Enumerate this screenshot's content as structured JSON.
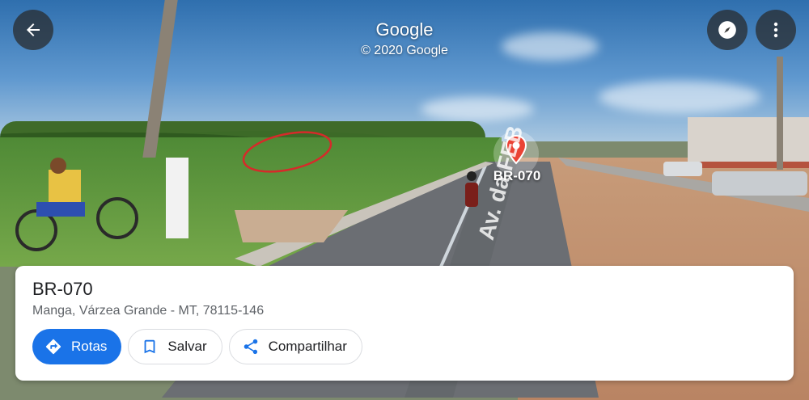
{
  "header": {
    "brand": "Google",
    "copyright": "© 2020 Google",
    "back_icon": "arrow-back-icon",
    "compass_icon": "compass-icon",
    "more_icon": "more-vert-icon"
  },
  "street_view": {
    "location_label": "BR-070",
    "road_marking": "Av. da FEB",
    "pin_color": "#ea4335"
  },
  "place_card": {
    "title": "BR-070",
    "address": "Manga, Várzea Grande - MT, 78115-146",
    "actions": [
      {
        "label": "Rotas",
        "icon": "directions-icon"
      },
      {
        "label": "Salvar",
        "icon": "bookmark-icon"
      },
      {
        "label": "Compartilhar",
        "icon": "share-icon"
      }
    ]
  },
  "colors": {
    "primary": "#1a73e8",
    "text_primary": "#202124",
    "text_secondary": "#5f6368"
  }
}
